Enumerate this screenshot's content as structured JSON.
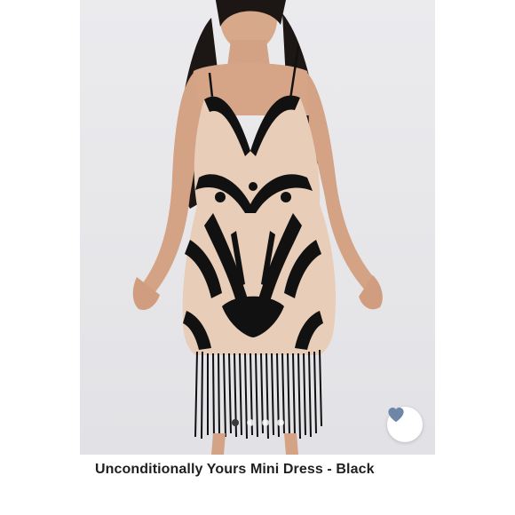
{
  "product": {
    "title": "Unconditionally Yours Mini Dress - Black"
  },
  "image": {
    "description": "model-wearing-black-lace-fringe-mini-dress"
  },
  "carousel": {
    "total_slides": 4,
    "active_index": 0
  },
  "wishlist": {
    "icon": "heart-icon",
    "color": "#6f86a6"
  },
  "colors": {
    "image_background": "#e9e9ec",
    "dress_black": "#111111",
    "lining_nude": "#e8cdb8",
    "title_text": "#1f1f1f"
  }
}
